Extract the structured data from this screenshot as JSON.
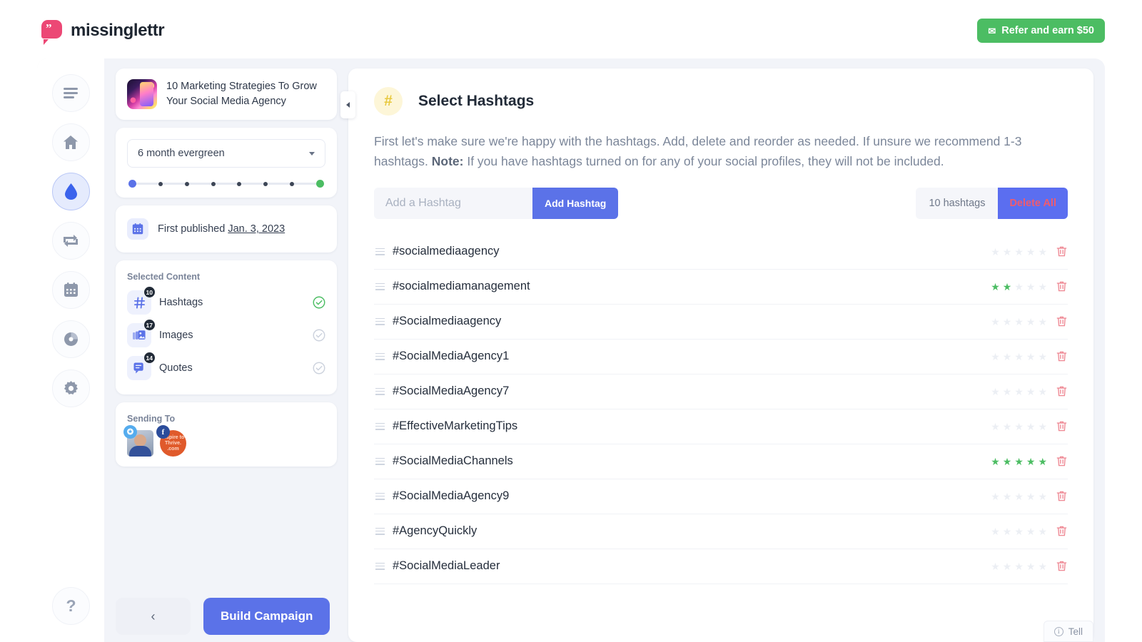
{
  "topbar": {
    "brand_name": "missinglettr",
    "refer_label": "Refer and earn $50",
    "refer_icon": "gift-icon",
    "refer_color": "#4cbd63"
  },
  "rail": {
    "items": [
      {
        "name": "menu-icon",
        "label": "Menu",
        "active": false
      },
      {
        "name": "home-icon",
        "label": "Home",
        "active": false
      },
      {
        "name": "drip-icon",
        "label": "Drip Campaigns",
        "active": true
      },
      {
        "name": "curate-icon",
        "label": "Curate",
        "active": false
      },
      {
        "name": "calendar-icon",
        "label": "Calendar",
        "active": false
      },
      {
        "name": "analytics-icon",
        "label": "Analytics",
        "active": false
      },
      {
        "name": "settings-icon",
        "label": "Settings",
        "active": false
      }
    ],
    "help_label": "?"
  },
  "campaign": {
    "title": "10 Marketing Strategies To Grow Your Social Media Agency",
    "schedule": "6 month evergreen",
    "progress_dots": 8,
    "published_label": "First published",
    "published_date": "Jan. 3, 2023",
    "selected_content_heading": "Selected Content",
    "content_items": [
      {
        "icon": "hashtag-icon",
        "label": "Hashtags",
        "badge": "10",
        "complete": true
      },
      {
        "icon": "images-icon",
        "label": "Images",
        "badge": "17",
        "complete": false
      },
      {
        "icon": "quotes-icon",
        "label": "Quotes",
        "badge": "14",
        "complete": false
      }
    ],
    "sending_to_heading": "Sending To",
    "accounts": [
      {
        "network": "twitter",
        "glyph": "t",
        "avatar": "profile-photo"
      },
      {
        "network": "facebook",
        "glyph": "f",
        "avatar": "inspire-to-thrive-logo",
        "logo_text": "Inspire to Thrive. .com"
      }
    ],
    "back_label": "‹",
    "build_label": "Build Campaign",
    "collapse_icon": "chevron-left-icon"
  },
  "main": {
    "icon": "hashtag-icon",
    "icon_glyph": "#",
    "title": "Select Hashtags",
    "description_part1": "First let's make sure we're happy with the hashtags. Add, delete and reorder as needed. If unsure we recommend 1-3 hashtags. ",
    "description_note_label": "Note:",
    "description_part2": " If you have hashtags turned on for any of your social profiles, they will not be included.",
    "input_placeholder": "Add a Hashtag",
    "input_value": "",
    "add_button": "Add Hashtag",
    "count_label": "10 hashtags",
    "delete_all_label": "Delete All",
    "delete_all_text_color": "#f05b6e",
    "delete_all_bg_color": "#5b6ef0",
    "star_on_color": "#4cbd63",
    "trash_color": "#ef8b96",
    "hashtags": [
      {
        "text": "#socialmediaagency",
        "rating": 0
      },
      {
        "text": "#socialmediamanagement",
        "rating": 2
      },
      {
        "text": "#Socialmediaagency",
        "rating": 0
      },
      {
        "text": "#SocialMediaAgency1",
        "rating": 0
      },
      {
        "text": "#SocialMediaAgency7",
        "rating": 0
      },
      {
        "text": "#EffectiveMarketingTips",
        "rating": 0
      },
      {
        "text": "#SocialMediaChannels",
        "rating": 5
      },
      {
        "text": "#SocialMediaAgency9",
        "rating": 0
      },
      {
        "text": "#AgencyQuickly",
        "rating": 0
      },
      {
        "text": "#SocialMediaLeader",
        "rating": 0
      }
    ]
  },
  "tell": {
    "label": "Tell",
    "icon": "info-icon"
  }
}
